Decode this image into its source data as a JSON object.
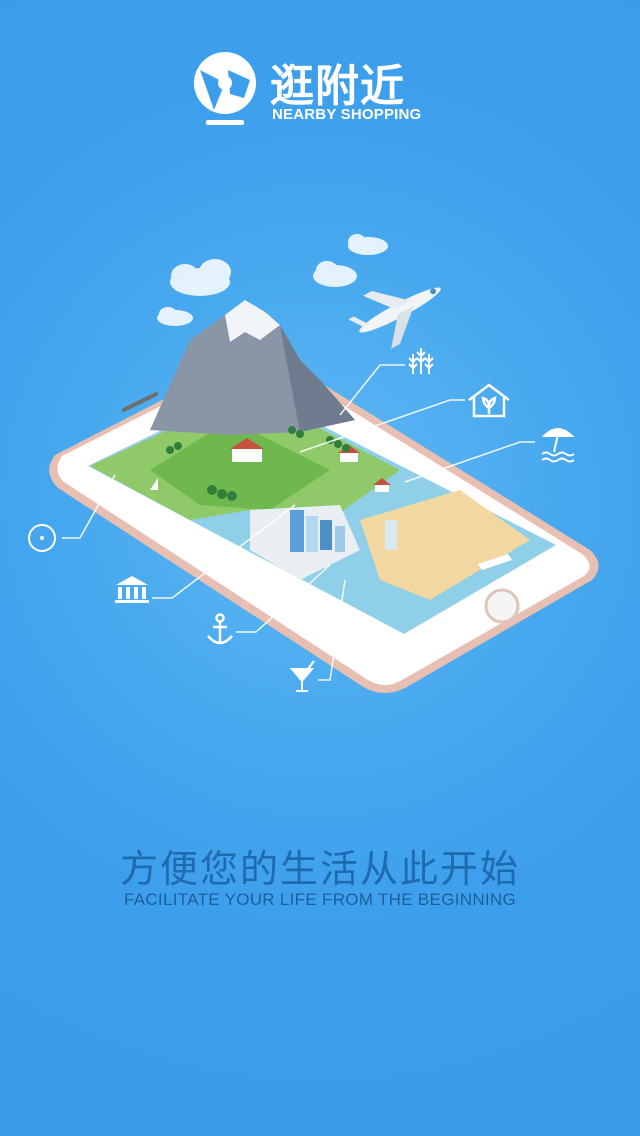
{
  "brand": {
    "title": "逛附近",
    "subtitle": "NEARBY SHOPPING"
  },
  "tagline": {
    "chinese": "方便您的生活从此开始",
    "english": "FACILITATE YOUR LIFE FROM THE BEGINNING"
  },
  "icons": [
    "compass-icon",
    "bank-icon",
    "anchor-icon",
    "cocktail-icon",
    "wheat-icon",
    "house-icon",
    "beach-umbrella-icon",
    "airplane-icon",
    "cloud-icon"
  ],
  "colors": {
    "background": "#3d9fec",
    "text_white": "#ffffff",
    "tagline_blue": "#1f6bb0",
    "phone_rose_gold": "#e8bfb3"
  }
}
